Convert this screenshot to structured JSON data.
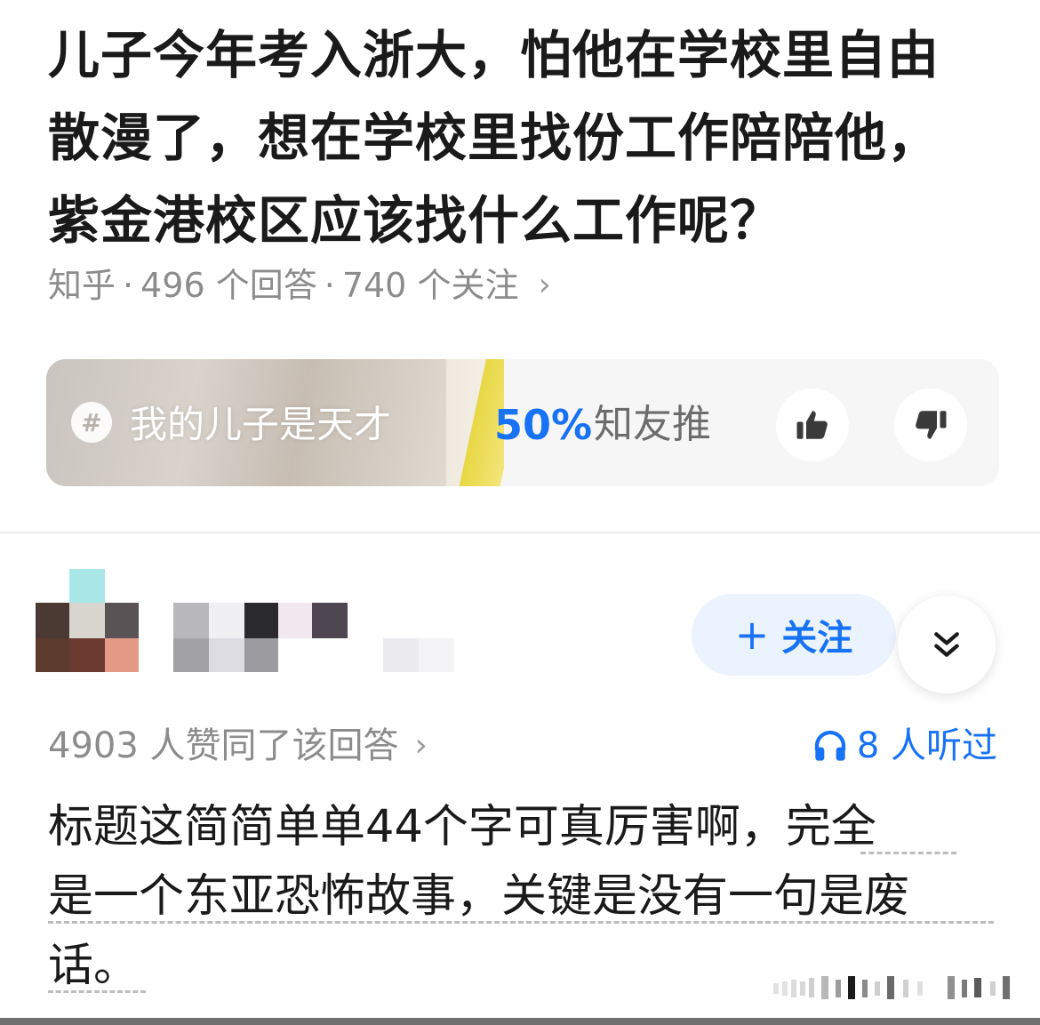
{
  "question": {
    "title_line1": "儿子今年考入浙大，怕他在学校里自由",
    "title_line2": "散漫了，想在学校里找份工作陪陪他，",
    "title_line3": "紫金港校区应该找什么工作呢？",
    "meta": {
      "site": "知乎",
      "answers": "496 个回答",
      "followers": "740 个关注",
      "separator": "·",
      "chevron": "›"
    }
  },
  "topic_card": {
    "hash": "#",
    "topic": "我的儿子是天才",
    "recommend_percent": "50%",
    "recommend_label": "知友推",
    "upvote_icon": "thumbs-up-icon",
    "downvote_icon": "thumbs-down-icon"
  },
  "answer": {
    "follow_label": "关注",
    "follow_plus": "+",
    "expand_icon": "double-chevron-down-icon",
    "vote_text": "4903 人赞同了该回答",
    "vote_chevron": "›",
    "listen_text": "8 人听过",
    "listen_icon": "headphones-icon",
    "body_line1": "标题这简简单单44个字可真厉害啊，完全",
    "body_line2": "是一个东亚恐怖故事，关键是没有一句是废",
    "body_line3": "话。"
  },
  "colors": {
    "accent": "#1772f6",
    "follow_bg": "#ebf3fe",
    "meta_gray": "#8c8c8c",
    "title": "#1a1a1a"
  }
}
